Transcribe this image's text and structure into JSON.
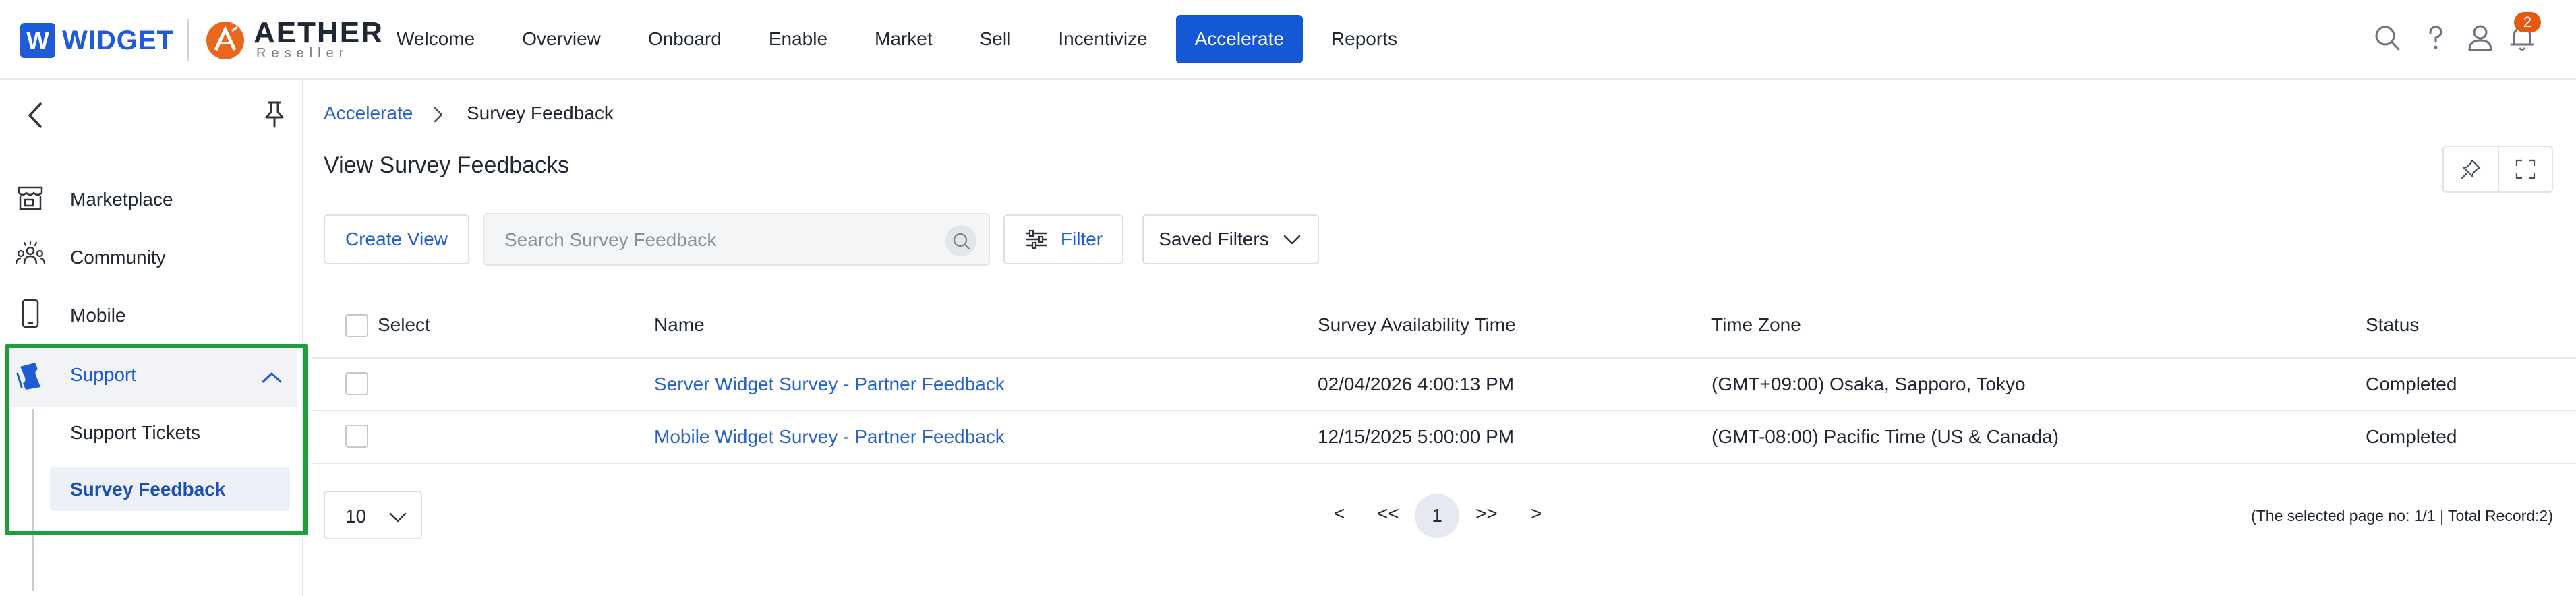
{
  "header": {
    "logo_letter": "W",
    "logo_text": "WIDGET",
    "reseller_name": "AETHER",
    "reseller_sub": "Reseller",
    "nav": [
      {
        "label": "Welcome"
      },
      {
        "label": "Overview"
      },
      {
        "label": "Onboard"
      },
      {
        "label": "Enable"
      },
      {
        "label": "Market"
      },
      {
        "label": "Sell"
      },
      {
        "label": "Incentivize"
      },
      {
        "label": "Accelerate",
        "active": true
      },
      {
        "label": "Reports"
      }
    ],
    "notification_count": "2",
    "accent_color": "#1558d6",
    "badge_color": "#e45a12"
  },
  "sidebar": {
    "items": [
      {
        "label": "Marketplace",
        "icon": "store-icon"
      },
      {
        "label": "Community",
        "icon": "community-icon"
      },
      {
        "label": "Mobile",
        "icon": "mobile-icon"
      },
      {
        "label": "Support",
        "icon": "ticket-icon",
        "expanded": true
      }
    ],
    "sub_items": [
      {
        "label": "Support Tickets"
      },
      {
        "label": "Survey Feedback",
        "active": true
      }
    ],
    "highlight_color": "#1f9d3a"
  },
  "breadcrumb": {
    "parent": "Accelerate",
    "current": "Survey Feedback"
  },
  "page": {
    "title": "View Survey Feedbacks"
  },
  "toolbar": {
    "create_view": "Create View",
    "search_placeholder": "Search Survey Feedback",
    "filter": "Filter",
    "saved_filters": "Saved Filters"
  },
  "table": {
    "columns": {
      "select": "Select",
      "name": "Name",
      "availability": "Survey Availability Time",
      "timezone": "Time Zone",
      "status": "Status"
    },
    "rows": [
      {
        "name": "Server Widget Survey - Partner Feedback",
        "availability": "02/04/2026 4:00:13 PM",
        "timezone": "(GMT+09:00) Osaka, Sapporo, Tokyo",
        "status": "Completed"
      },
      {
        "name": "Mobile Widget Survey - Partner Feedback",
        "availability": "12/15/2025 5:00:00 PM",
        "timezone": "(GMT-08:00) Pacific Time (US & Canada)",
        "status": "Completed"
      }
    ]
  },
  "pagination": {
    "page_size": "10",
    "prev": "<",
    "first": "<<",
    "current": "1",
    "last": ">>",
    "next": ">",
    "summary": "(The selected page no: 1/1 | Total Record:2)"
  }
}
